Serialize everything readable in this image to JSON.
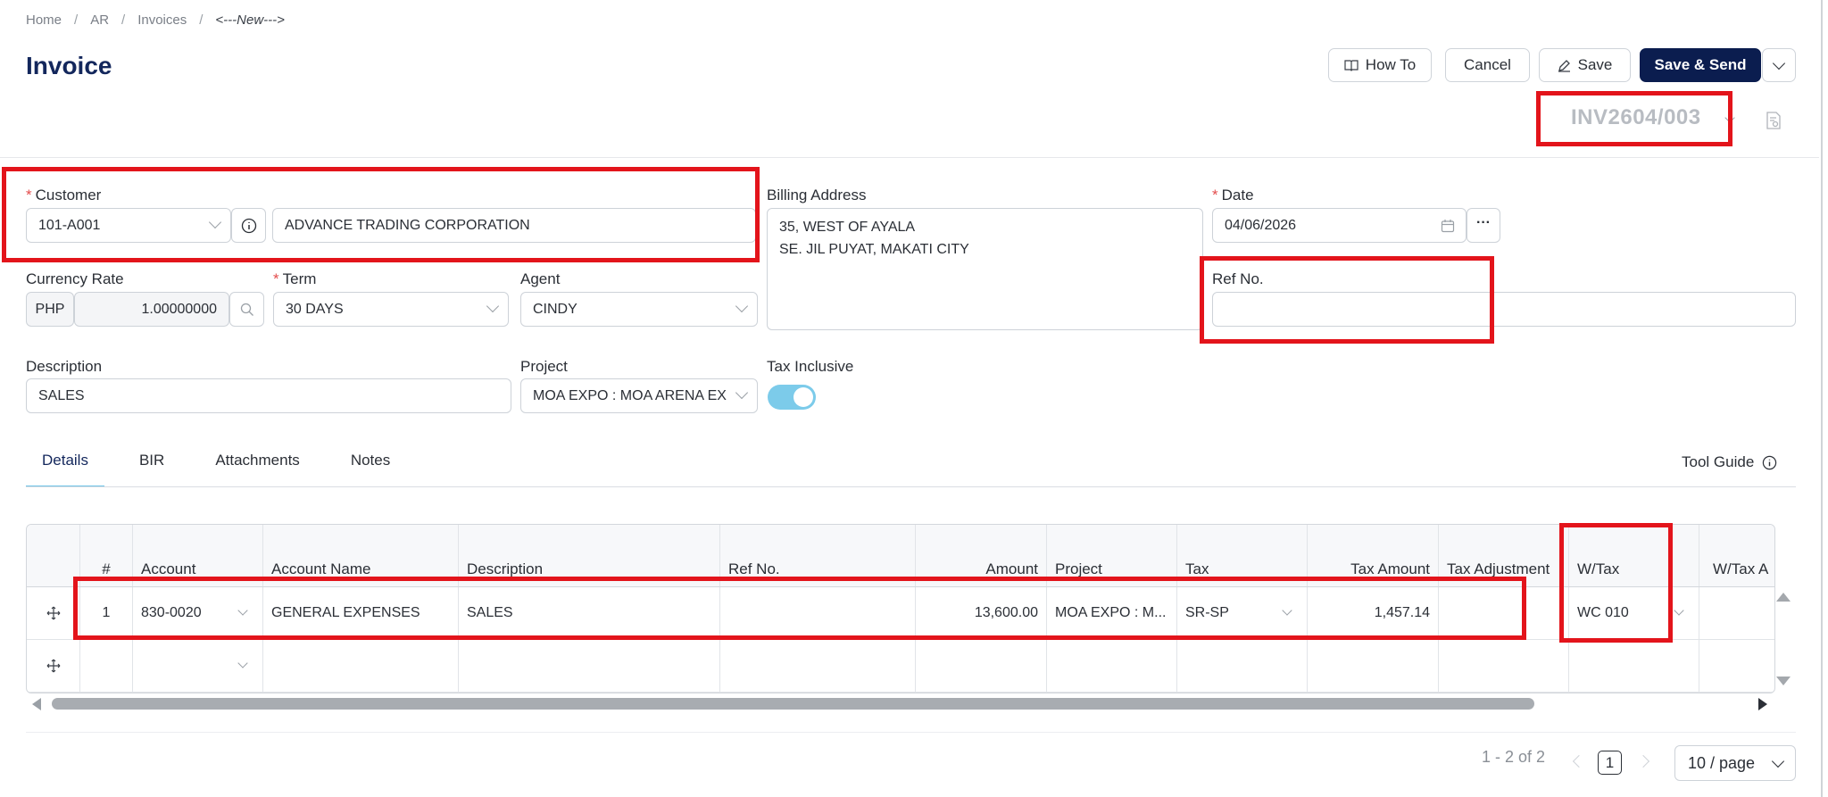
{
  "breadcrumb": [
    "Home",
    "AR",
    "Invoices",
    "<---New--->"
  ],
  "page": {
    "title": "Invoice"
  },
  "toolbar": {
    "how_to": "How To",
    "cancel": "Cancel",
    "save": "Save",
    "save_send": "Save & Send"
  },
  "invoice_number": "INV2604/003",
  "form": {
    "customer_label": "Customer",
    "customer_code": "101-A001",
    "customer_name": "ADVANCE TRADING CORPORATION",
    "billing_label": "Billing Address",
    "billing_line1": "35, WEST OF AYALA",
    "billing_line2": "SE. JIL PUYAT, MAKATI CITY",
    "date_label": "Date",
    "date_value": "04/06/2026",
    "currency_label": "Currency Rate",
    "currency": "PHP",
    "rate": "1.00000000",
    "term_label": "Term",
    "term_value": "30 DAYS",
    "agent_label": "Agent",
    "agent_value": "CINDY",
    "ref_label": "Ref No.",
    "ref_value": "",
    "description_label": "Description",
    "description_value": "SALES",
    "project_label": "Project",
    "project_value": "MOA EXPO : MOA ARENA EX...",
    "tax_inclusive_label": "Tax Inclusive",
    "tax_inclusive": true
  },
  "tabs": [
    "Details",
    "BIR",
    "Attachments",
    "Notes"
  ],
  "tool_guide": "Tool Guide",
  "grid": {
    "columns": [
      "#",
      "Account",
      "Account Name",
      "Description",
      "Ref No.",
      "Amount",
      "Project",
      "Tax",
      "Tax Amount",
      "Tax Adjustment",
      "W/Tax",
      "W/Tax A"
    ],
    "rows": [
      {
        "num": "1",
        "account": "830-0020",
        "account_name": "GENERAL EXPENSES",
        "description": "SALES",
        "ref_no": "",
        "amount": "13,600.00",
        "project": "MOA EXPO : M...",
        "tax": "SR-SP",
        "tax_amount": "1,457.14",
        "tax_adjustment": "",
        "wtax": "WC 010"
      }
    ]
  },
  "pagination": {
    "range": "1 - 2 of 2",
    "current_page": "1",
    "page_size": "10 / page"
  },
  "colors": {
    "title": "#13275c",
    "primary": "#0b1d4f",
    "accent": "#6fc3e8",
    "annotation": "#e3141b"
  }
}
